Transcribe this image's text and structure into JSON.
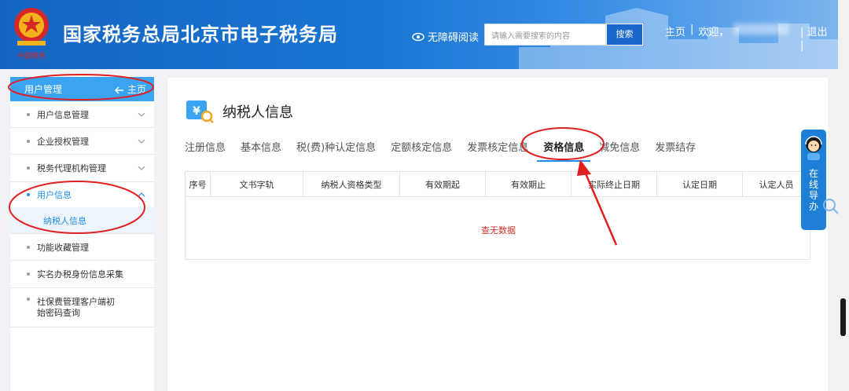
{
  "header": {
    "site_title": "国家税务总局北京市电子税务局",
    "accessibility_label": "无障碍阅读",
    "search_placeholder": "请输入需要搜索的内容",
    "search_button": "搜索",
    "nav_home": "主页",
    "nav_sep1": "|",
    "nav_welcome": "欢迎，",
    "nav_sep2": "|",
    "logout": "退出",
    "nav_sep3": "|"
  },
  "sidebar": {
    "head_label": "用户管理",
    "head_right": "主页",
    "items": [
      {
        "label": "用户信息管理"
      },
      {
        "label": "企业授权管理"
      },
      {
        "label": "税务代理机构管理"
      },
      {
        "label": "用户信息"
      },
      {
        "label": "功能收藏管理"
      },
      {
        "label": "实名办税身份信息采集"
      },
      {
        "label": "社保费管理客户端初始密码查询"
      }
    ],
    "sub_item": "纳税人信息"
  },
  "main": {
    "title": "纳税人信息",
    "tabs": [
      "注册信息",
      "基本信息",
      "税(费)种认定信息",
      "定额核定信息",
      "发票核定信息",
      "资格信息",
      "减免信息",
      "发票结存"
    ],
    "active_tab": "资格信息",
    "columns": [
      "序号",
      "文书字轨",
      "纳税人资格类型",
      "有效期起",
      "有效期止",
      "实际终止日期",
      "认定日期",
      "认定人员"
    ],
    "empty_text": "查无数据"
  },
  "float_help": {
    "label": "在线导办"
  },
  "colors": {
    "accent": "#1e8ee6",
    "header_blue": "#1976d2",
    "annotation_red": "#e02020"
  }
}
